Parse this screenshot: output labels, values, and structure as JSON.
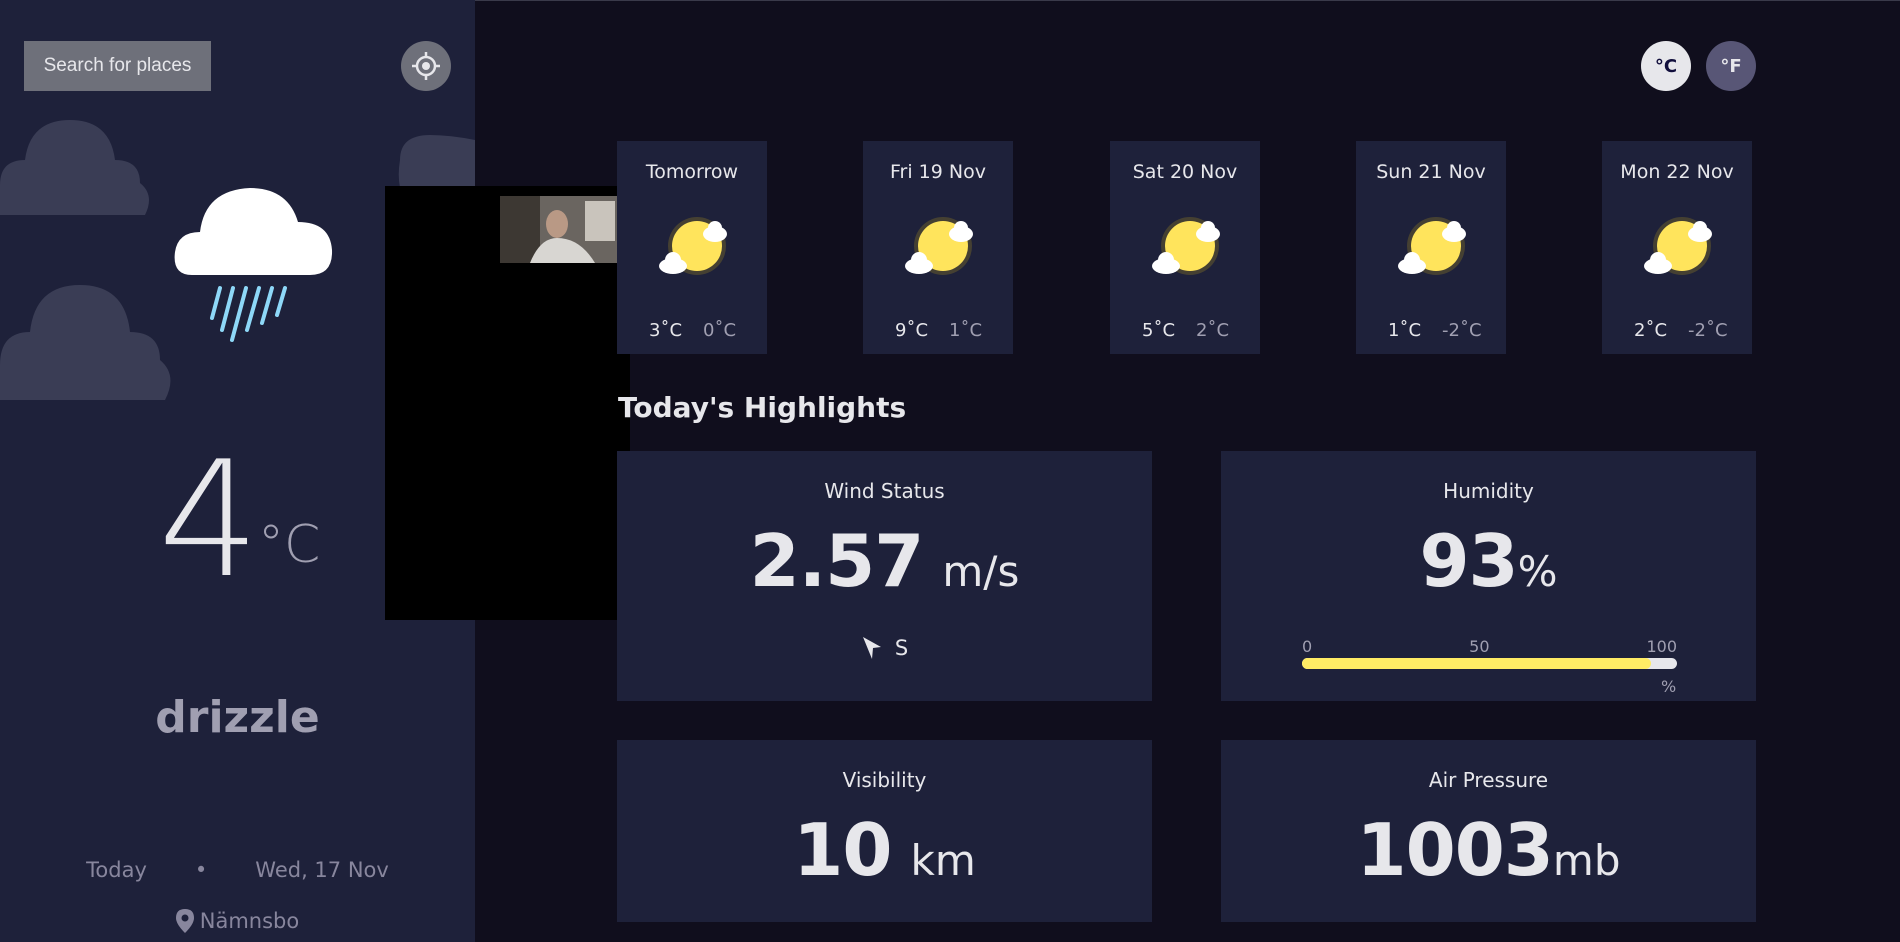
{
  "sidebar": {
    "search_label": "Search for places",
    "location_icon": "crosshair-icon",
    "weather_icon": "drizzle-cloud-icon",
    "temperature": "4",
    "temperature_unit": "°C",
    "condition": "drizzle",
    "today_label": "Today",
    "separator": "•",
    "date": "Wed, 17 Nov",
    "location": "Nämnsbo"
  },
  "units": {
    "celsius": "°C",
    "fahrenheit": "°F"
  },
  "forecast": [
    {
      "day": "Tomorrow",
      "max": "3˚C",
      "min": "0˚C",
      "icon": "sun-cloud-icon"
    },
    {
      "day": "Fri 19 Nov",
      "max": "9˚C",
      "min": "1˚C",
      "icon": "sun-cloud-icon"
    },
    {
      "day": "Sat 20 Nov",
      "max": "5˚C",
      "min": "2˚C",
      "icon": "sun-cloud-icon"
    },
    {
      "day": "Sun 21 Nov",
      "max": "1˚C",
      "min": "-2˚C",
      "icon": "sun-cloud-icon"
    },
    {
      "day": "Mon 22 Nov",
      "max": "2˚C",
      "min": "-2˚C",
      "icon": "sun-cloud-icon"
    }
  ],
  "highlights": {
    "title": "Today's Highlights",
    "wind": {
      "label": "Wind Status",
      "value": "2.57",
      "unit": "m/s",
      "direction": "S"
    },
    "humidity": {
      "label": "Humidity",
      "value": "93",
      "unit": "%",
      "scale_min": "0",
      "scale_mid": "50",
      "scale_max": "100",
      "scale_unit": "%",
      "percent": 93
    },
    "visibility": {
      "label": "Visibility",
      "value": "10",
      "unit": "km"
    },
    "pressure": {
      "label": "Air Pressure",
      "value": "1003",
      "unit": "mb"
    }
  },
  "colors": {
    "sidebar_bg": "#1e213a",
    "main_bg": "#100e1d",
    "bar_fill": "#ffec65",
    "rain": "#8ed8f8"
  }
}
